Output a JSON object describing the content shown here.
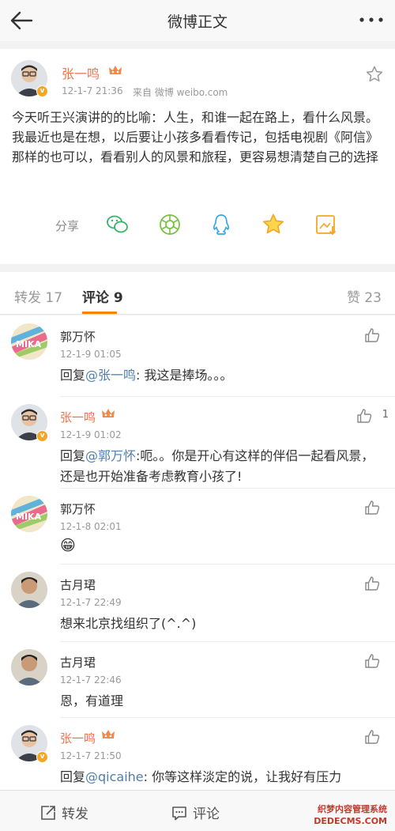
{
  "header": {
    "title": "微博正文"
  },
  "post": {
    "author": "张一鸣",
    "time": "12-1-7 21:36",
    "source": "来自 微博 weibo.com",
    "body": "今天听王兴演讲的的比喻：人生，和谁一起在路上，看什么风景。 我最近也是在想，以后要让小孩多看看传记，包括电视剧《阿信》那样的也可以，看看别人的风景和旅程，更容易想清楚自己的选择",
    "share_label": "分享"
  },
  "tabs": {
    "repost": "转发 17",
    "comments": "评论 9",
    "likes": "赞 23"
  },
  "comments": [
    {
      "name": "郭万怀",
      "time": "12-1-9 01:05",
      "prefix": "回复",
      "mention": "@张一鸣",
      "text": ": 我这是捧场。。。"
    },
    {
      "name": "张一鸣",
      "time": "12-1-9 01:02",
      "prefix": "回复",
      "mention": "@郭万怀",
      "text": ":呃。。你是开心有这样的伴侣一起看风景，还是也开始准备考虑教育小孩了!",
      "likes": "1"
    },
    {
      "name": "郭万怀",
      "time": "12-1-8 02:01",
      "text": "😁"
    },
    {
      "name": "古月珺",
      "time": "12-1-7 22:49",
      "text": "想来北京找组织了(^.^)"
    },
    {
      "name": "古月珺",
      "time": "12-1-7 22:46",
      "text": "恩，有道理"
    },
    {
      "name": "张一鸣",
      "time": "12-1-7 21:50",
      "prefix": "回复",
      "mention": "@qicaihe",
      "text": ": 你等这样淡定的说，让我好有压力"
    }
  ],
  "bottom": {
    "repost": "转发",
    "comment": "评论"
  },
  "watermark": {
    "line1": "织梦内容管理系统",
    "line2": "DEDECMS.COM"
  },
  "colors": {
    "accent": "#ff8200",
    "vip_name": "#eb7350",
    "mention": "#507daf"
  }
}
